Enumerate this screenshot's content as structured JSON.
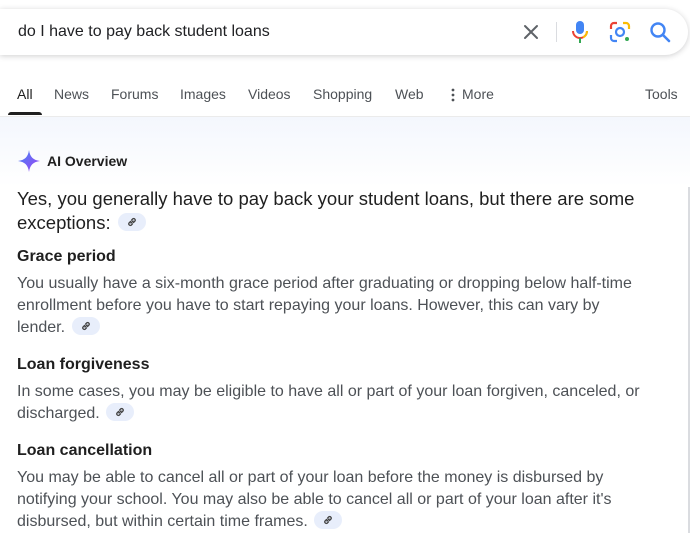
{
  "search": {
    "query": "do I have to pay back student loans"
  },
  "icons": {
    "clear": "close-icon",
    "mic": "microphone-icon",
    "lens": "google-lens-icon",
    "search": "search-icon",
    "more": "vertical-dots-icon",
    "ai": "sparkle-icon",
    "citation": "link-icon"
  },
  "tabs": [
    {
      "label": "All",
      "active": true
    },
    {
      "label": "News"
    },
    {
      "label": "Forums"
    },
    {
      "label": "Images"
    },
    {
      "label": "Videos"
    },
    {
      "label": "Shopping"
    },
    {
      "label": "Web"
    },
    {
      "label": "More"
    }
  ],
  "tools_label": "Tools",
  "ai_overview": {
    "title": "AI Overview",
    "answer": "Yes, you generally have to pay back your student loans, but there are some exceptions:",
    "sections": [
      {
        "title": "Grace period",
        "text": "You usually have a six-month grace period after graduating or dropping below half-time enrollment before you have to start repaying your loans. However, this can vary by lender."
      },
      {
        "title": "Loan forgiveness",
        "text": "In some cases, you may be eligible to have all or part of your loan forgiven, canceled, or discharged."
      },
      {
        "title": "Loan cancellation",
        "text": "You may be able to cancel all or part of your loan before the money is disbursed by notifying your school. You may also be able to cancel all or part of your loan after it's disbursed, but within certain time frames."
      }
    ]
  },
  "colors": {
    "accent_blue": "#4285f4",
    "red": "#ea4335",
    "yellow": "#fbbc04",
    "green": "#34a853",
    "citation_bg": "#e8eefb",
    "body_text": "#4d5156"
  }
}
